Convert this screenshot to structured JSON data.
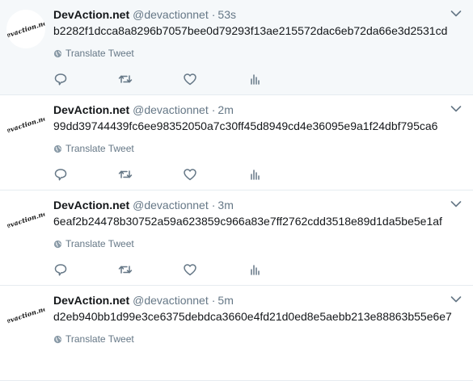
{
  "tweets": [
    {
      "name": "DevAction.net",
      "handle": "@devactionnet",
      "separator": "·",
      "time": "53s",
      "text": "b2282f1dcca8a8296b7057bee0d79293f13ae215572dac6eb72da66e3d2531cd",
      "translate_label": "Translate Tweet",
      "avatar_text": "devaction.net",
      "highlighted": true
    },
    {
      "name": "DevAction.net",
      "handle": "@devactionnet",
      "separator": "·",
      "time": "2m",
      "text": "99dd39744439fc6ee98352050a7c30ff45d8949cd4e36095e9a1f24dbf795ca6",
      "translate_label": "Translate Tweet",
      "avatar_text": "devaction.net",
      "highlighted": false
    },
    {
      "name": "DevAction.net",
      "handle": "@devactionnet",
      "separator": "·",
      "time": "3m",
      "text": "6eaf2b24478b30752a59a623859c966a83e7ff2762cdd3518e89d1da5be5e1af",
      "translate_label": "Translate Tweet",
      "avatar_text": "devaction.net",
      "highlighted": false
    },
    {
      "name": "DevAction.net",
      "handle": "@devactionnet",
      "separator": "·",
      "time": "5m",
      "text": "d2eb940bb1d99e3ce6375debdca3660e4fd21d0ed8e5aebb213e88863b55e6e7",
      "translate_label": "Translate Tweet",
      "avatar_text": "devaction.net",
      "highlighted": false
    }
  ],
  "icons": {
    "caret": "chevron-down-icon",
    "globe": "globe-icon",
    "reply": "reply-icon",
    "retweet": "retweet-icon",
    "like": "like-icon",
    "analytics": "analytics-icon"
  },
  "colors": {
    "text": "#14171a",
    "secondary": "#657786",
    "border": "#e6ecf0",
    "highlight_bg": "#f5f8fa"
  }
}
